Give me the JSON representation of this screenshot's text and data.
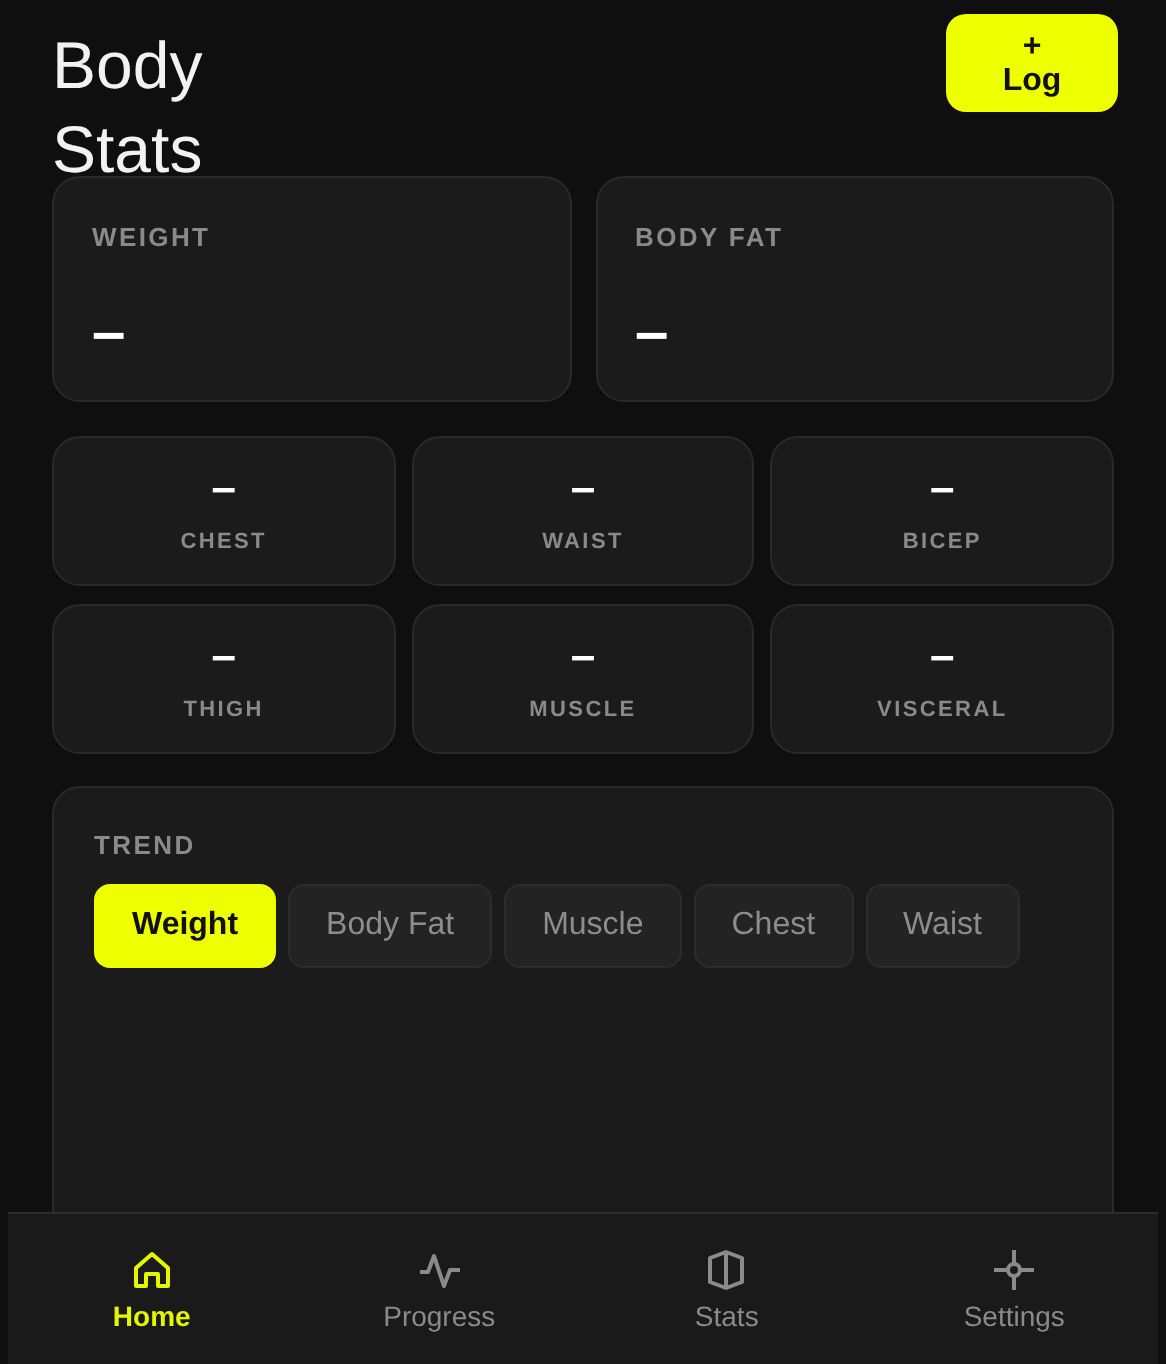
{
  "header": {
    "title": "Body Stats",
    "log_button": {
      "icon": "+",
      "label": "Log"
    }
  },
  "main_stats": [
    {
      "label": "WEIGHT",
      "value": "–"
    },
    {
      "label": "BODY FAT",
      "value": "–"
    }
  ],
  "metrics": [
    {
      "label": "CHEST",
      "value": "–"
    },
    {
      "label": "WAIST",
      "value": "–"
    },
    {
      "label": "BICEP",
      "value": "–"
    },
    {
      "label": "THIGH",
      "value": "–"
    },
    {
      "label": "MUSCLE",
      "value": "–"
    },
    {
      "label": "VISCERAL",
      "value": "–"
    }
  ],
  "trend": {
    "title": "TREND",
    "chips": [
      {
        "label": "Weight",
        "selected": true
      },
      {
        "label": "Body Fat",
        "selected": false
      },
      {
        "label": "Muscle",
        "selected": false
      },
      {
        "label": "Chest",
        "selected": false
      },
      {
        "label": "Waist",
        "selected": false
      }
    ]
  },
  "nav": [
    {
      "kind": "home",
      "label": "Home",
      "selected": true
    },
    {
      "kind": "progress",
      "label": "Progress",
      "selected": false
    },
    {
      "kind": "stats",
      "label": "Stats",
      "selected": false
    },
    {
      "kind": "settings",
      "label": "Settings",
      "selected": false
    }
  ]
}
